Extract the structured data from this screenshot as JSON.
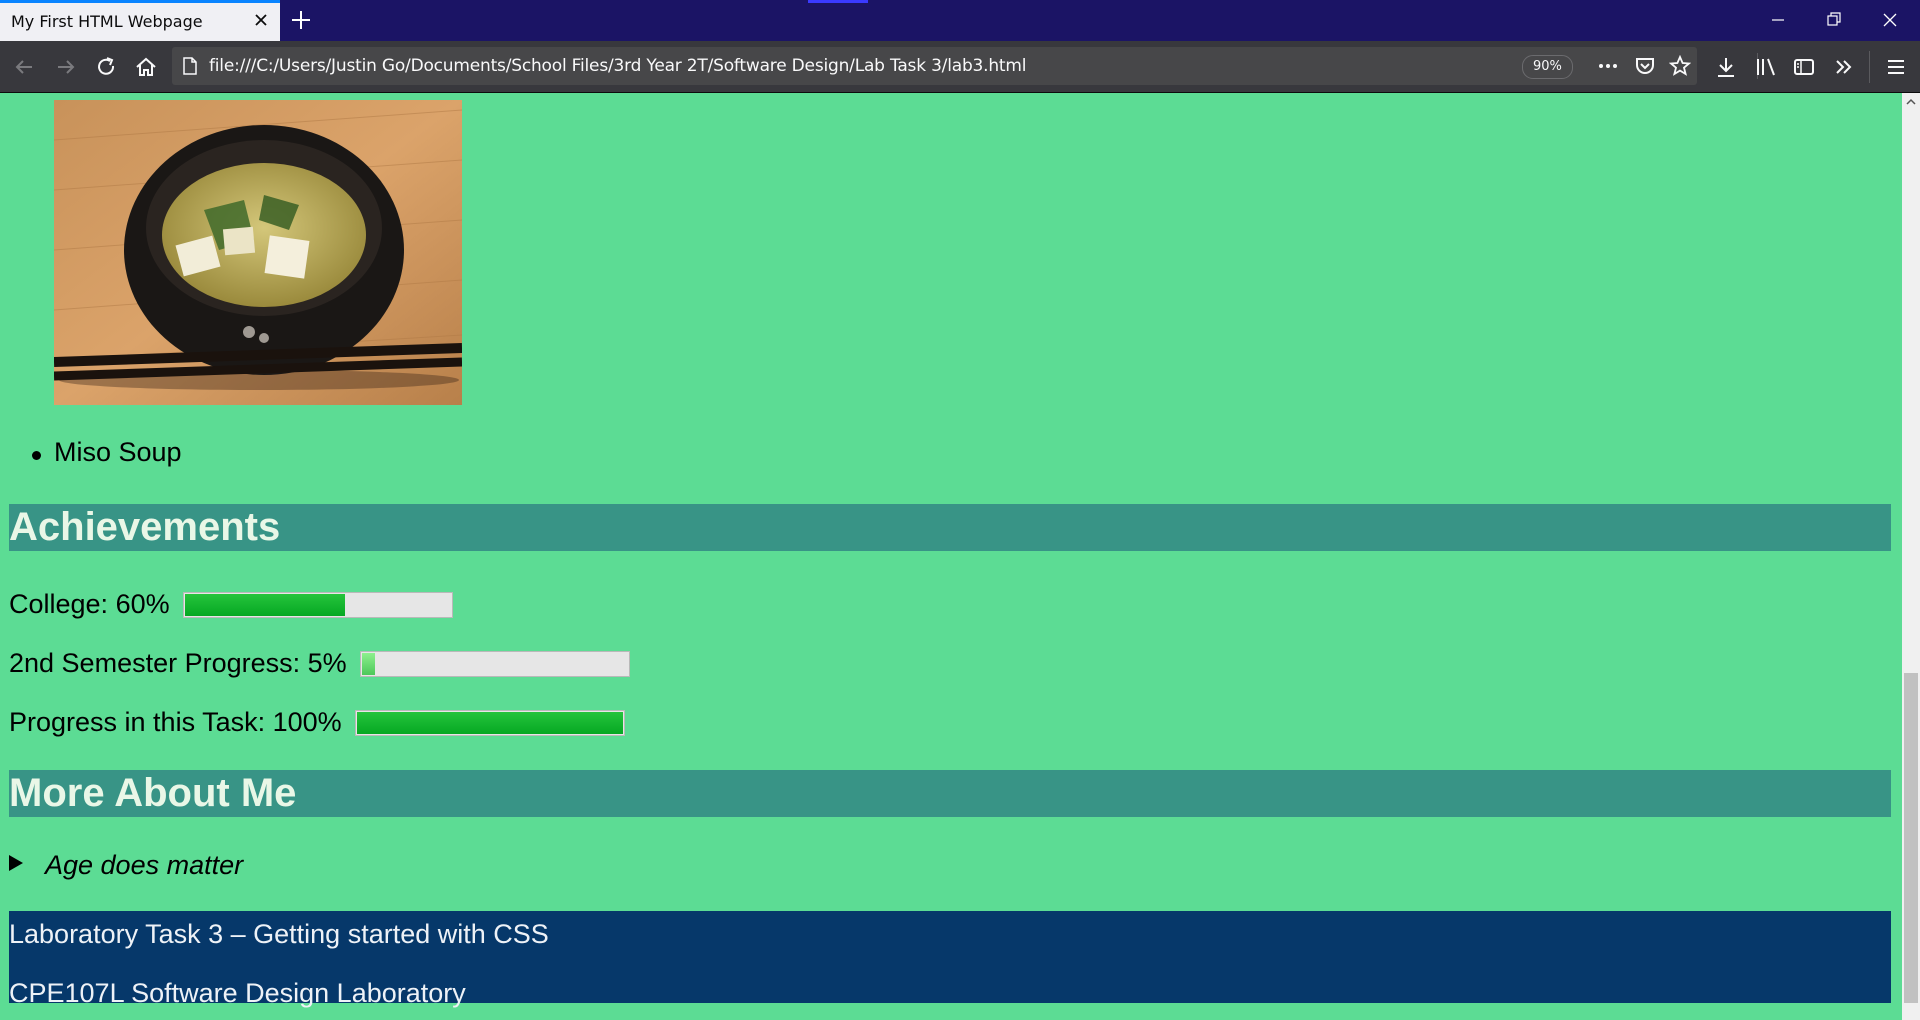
{
  "browser": {
    "tab_title": "My First HTML Webpage",
    "url": "file:///C:/Users/Justin Go/Documents/School Files/3rd Year 2T/Software Design/Lab Task 3/lab3.html",
    "zoom": "90%"
  },
  "page": {
    "favorite_food": {
      "image_alt": "Miso soup in a black bowl with chopsticks",
      "items": [
        "Miso Soup"
      ]
    },
    "achievements": {
      "heading": "Achievements",
      "rows": [
        {
          "label": "College: 60%",
          "value": 0.6
        },
        {
          "label": "2nd Semester Progress: 5%",
          "value": 0.05
        },
        {
          "label": "Progress in this Task: 100%",
          "value": 1.0
        }
      ]
    },
    "more_about_me": {
      "heading": "More About Me",
      "details_summary": "Age does matter"
    },
    "footer": {
      "line1": "Laboratory Task 3 – Getting started with CSS",
      "line2": "CPE107L Software Design Laboratory"
    }
  },
  "colors": {
    "page_bg": "#5cdc94",
    "header_bg": "#389486",
    "header_text": "#e9f7e7",
    "footer_bg": "#06386a",
    "progress_fill": "#06a823",
    "tabbar_bg": "#1b1465",
    "navbar_bg": "#38383d"
  }
}
